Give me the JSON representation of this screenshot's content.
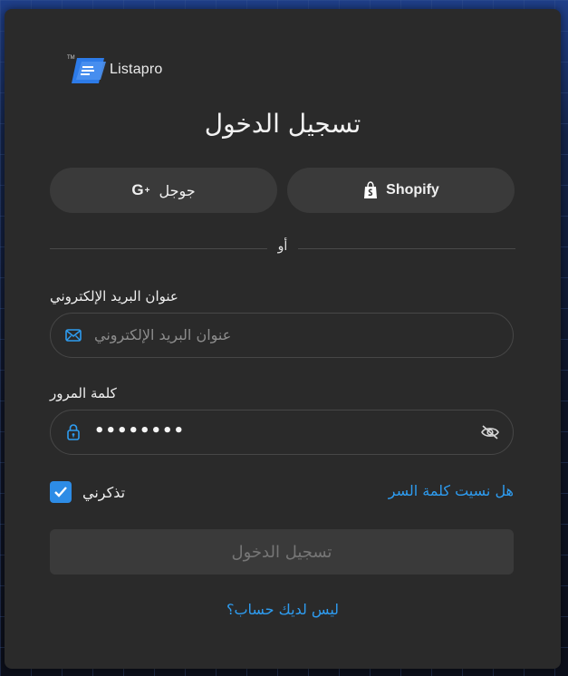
{
  "brand": {
    "name": "Listapro",
    "trademark": "TM",
    "color": "#2d7be8"
  },
  "page": {
    "title": "تسجيل الدخول"
  },
  "social": {
    "google_label": "جوجل",
    "google_icon": "G+",
    "shopify_label": "Shopify"
  },
  "divider_text": "أو",
  "email": {
    "label": "عنوان البريد الإلكتروني",
    "placeholder": "عنوان البريد الإلكتروني",
    "value": ""
  },
  "password": {
    "label": "كلمة المرور",
    "value": "••••••••"
  },
  "remember": {
    "label": "تذكرني",
    "checked": true
  },
  "forgot_link": "هل نسيت كلمة السر",
  "submit_label": "تسجيل الدخول",
  "signup_link": "ليس لديك حساب؟",
  "colors": {
    "accent": "#2e9cf0",
    "card": "#2a2a2a",
    "button": "#3a3a3a"
  }
}
